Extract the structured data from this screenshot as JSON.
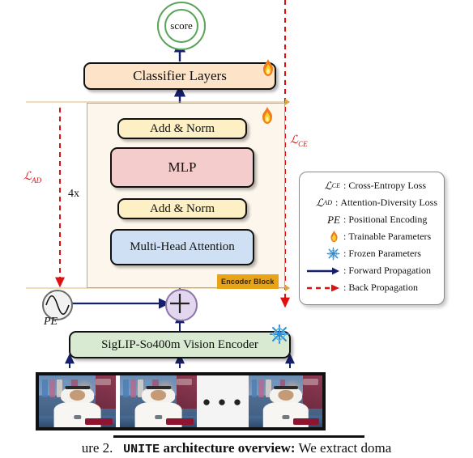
{
  "figure": {
    "caption_prefix": "ure 2.",
    "caption_bold_mono": "UNITE",
    "caption_bold": " architecture overview:",
    "caption_rest": " We extract doma"
  },
  "nodes": {
    "score": {
      "label": "score"
    },
    "classifier": {
      "label": "Classifier Layers",
      "color": "#fde4c8"
    },
    "add_norm_top": {
      "label": "Add & Norm",
      "color": "#fdf0c4"
    },
    "mlp": {
      "label": "MLP",
      "color": "#f4cccc"
    },
    "add_norm_bottom": {
      "label": "Add & Norm",
      "color": "#fdf0c4"
    },
    "attention": {
      "label": "Multi-Head Attention",
      "color": "#cfe0f5"
    },
    "encoder_block_tag": {
      "label": "Encoder Block",
      "color": "#e8a317"
    },
    "vision_encoder": {
      "label": "SigLIP-So400m Vision Encoder",
      "color": "#d9ead3"
    },
    "pe": {
      "label": "PE"
    },
    "sum": {
      "label": "+"
    }
  },
  "annotations": {
    "loss_ad": "ℒ",
    "loss_ad_sub": "AD",
    "loss_ce": "ℒ",
    "loss_ce_sub": "CE",
    "repeat": "4x"
  },
  "legend": {
    "rows": [
      {
        "key_type": "text",
        "key": "ℒ",
        "key_sub": "CE",
        "text": "Cross-Entropy Loss"
      },
      {
        "key_type": "text",
        "key": "ℒ",
        "key_sub": "AD",
        "text": "Attention-Diversity Loss"
      },
      {
        "key_type": "text",
        "key": "PE",
        "key_sub": "",
        "text": "Positional Encoding"
      },
      {
        "key_type": "flame",
        "key": "",
        "key_sub": "",
        "text": "Trainable Parameters"
      },
      {
        "key_type": "snowflake",
        "key": "",
        "key_sub": "",
        "text": "Frozen Parameters"
      },
      {
        "key_type": "arrow-solid",
        "key": "",
        "key_sub": "",
        "text": "Forward Propagation"
      },
      {
        "key_type": "arrow-dashed",
        "key": "",
        "key_sub": "",
        "text": "Back Propagation"
      }
    ]
  },
  "frames": {
    "gap_dots": "● ● ●",
    "count": 4
  },
  "colors": {
    "forward_arrow": "#15206b",
    "back_arrow": "#e01010",
    "score_ring": "#5aa35a",
    "encoder_border": "#d9a441",
    "encoder_fill": "#fdf6ec",
    "sum_fill": "#e3d7ef",
    "sum_border": "#8c74a8"
  }
}
